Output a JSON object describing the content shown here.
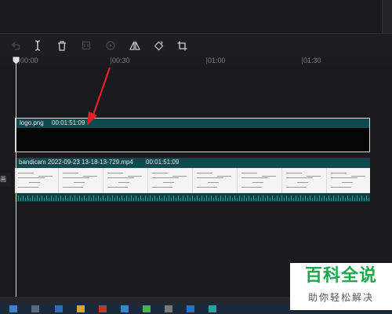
{
  "toolbar": {
    "tools": [
      "undo-icon",
      "split-icon",
      "delete-icon",
      "freeze-frame-icon",
      "play-icon",
      "mirror-icon",
      "rotate-icon",
      "crop-icon"
    ]
  },
  "ruler": {
    "ticks": [
      "00:00",
      "00:30",
      "01:00",
      "01:30"
    ]
  },
  "tracks": {
    "logo_clip": {
      "name": "logo.png",
      "duration": "00:01:51:09"
    },
    "video_clip": {
      "name": "bandicam 2022-09-23 13-18-13-729.mp4",
      "duration": "00:01:51:09"
    },
    "side_label": "画"
  },
  "annotation": {
    "arrow_color": "#e0202a"
  },
  "watermark": {
    "title": "百科全说",
    "subtitle": "助你轻松解决"
  },
  "colors": {
    "clip_header": "#0f4a4e",
    "playhead": "#d8d8d8",
    "watermark_green": "#1fa84a"
  }
}
